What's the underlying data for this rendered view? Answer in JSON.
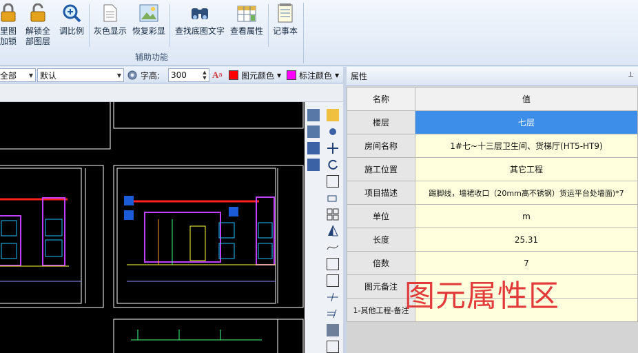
{
  "ribbon": {
    "buttons": [
      {
        "label": "里图\n加锁",
        "icon": "lock-icon"
      },
      {
        "label": "解锁全\n部图层",
        "icon": "unlock-icon"
      },
      {
        "label": "调比例",
        "icon": "zoom-scale-icon"
      },
      {
        "label": "灰色显示",
        "icon": "document-gray-icon"
      },
      {
        "label": "恢复彩显",
        "icon": "picture-icon"
      },
      {
        "label": "查找底图文字",
        "icon": "binoculars-icon"
      },
      {
        "label": "查看属性",
        "icon": "table-properties-icon"
      },
      {
        "label": "记事本",
        "icon": "notepad-icon"
      }
    ],
    "group_label": "辅助功能"
  },
  "toolbar": {
    "layer_combo": "全部",
    "style_combo": "默认",
    "font_height_label": "字高:",
    "font_height_value": "300",
    "element_color_label": "图元颜色",
    "element_color": "#ff0000",
    "annotation_color_label": "标注颜色",
    "annotation_color": "#ff00ff"
  },
  "properties": {
    "title": "属性",
    "pin": "ᵖ",
    "header": {
      "key": "名称",
      "value": "值"
    },
    "rows": [
      {
        "key": "楼层",
        "value": "七层"
      },
      {
        "key": "房间名称",
        "value": "1#七~十三层卫生间、货梯厅(HT5-HT9)"
      },
      {
        "key": "施工位置",
        "value": "其它工程"
      },
      {
        "key": "项目描述",
        "value": "踢脚线，墙裙收口（20mm高不锈钢）货运平台处墙面)*7"
      },
      {
        "key": "单位",
        "value": "m"
      },
      {
        "key": "长度",
        "value": "25.31"
      },
      {
        "key": "倍数",
        "value": "7"
      },
      {
        "key": "图元备注",
        "value": ""
      },
      {
        "key": "1-其他工程-备注",
        "value": ""
      }
    ]
  },
  "overlay_label": "图元属性区"
}
